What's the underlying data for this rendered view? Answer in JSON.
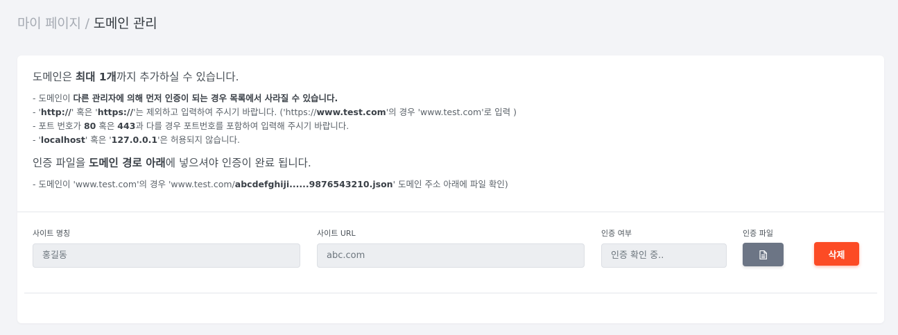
{
  "breadcrumb": {
    "parent": "마이 페이지",
    "separator": "/",
    "current": "도메인 관리"
  },
  "info": {
    "main1_pre": "도메인은 ",
    "main1_bold": "최대 1개",
    "main1_post": "까지 추가하실 수 있습니다.",
    "note1_pre": "- 도메인이 ",
    "note1_bold": "다른 관리자에 의해 먼저 인증이 되는 경우 목록에서 사라질 수 있습니다.",
    "note2_a": "- '",
    "note2_b": "http://",
    "note2_c": "' 혹은 '",
    "note2_d": "https://",
    "note2_e": "'는 제외하고 입력하여 주시기 바랍니다. ('https://",
    "note2_f": "www.test.com",
    "note2_g": "'의 경우 'www.test.com'로 입력 )",
    "note3_a": "- 포트 번호가 ",
    "note3_b": "80",
    "note3_c": " 혹은 ",
    "note3_d": "443",
    "note3_e": "과 다를 경우 포트번호를 포함하여 입력해 주시기 바랍니다.",
    "note4_a": "- '",
    "note4_b": "localhost",
    "note4_c": "' 혹은 '",
    "note4_d": "127.0.0.1",
    "note4_e": "'은 허용되지 않습니다.",
    "main2_pre": "인증 파일을 ",
    "main2_bold": "도메인 경로 아래",
    "main2_post": "에 넣으셔야 인증이 완료 됩니다.",
    "note5_a": "- 도메인이 'www.test.com'의 경우 'www.test.com/",
    "note5_b": "abcdefghiji......9876543210.json",
    "note5_c": "' 도메인 주소 아래에 파일 확인)"
  },
  "form": {
    "site_name_label": "사이트 명칭",
    "site_name_value": "홍길동",
    "site_url_label": "사이트 URL",
    "site_url_value": "abc.com",
    "auth_status_label": "인증 여부",
    "auth_status_value": "인증 확인 중..",
    "auth_file_label": "인증 파일",
    "auth_file_icon": "document-icon",
    "delete_label": "삭제"
  },
  "colors": {
    "delete_button": "#fc4b25",
    "file_button": "#6c7585"
  }
}
